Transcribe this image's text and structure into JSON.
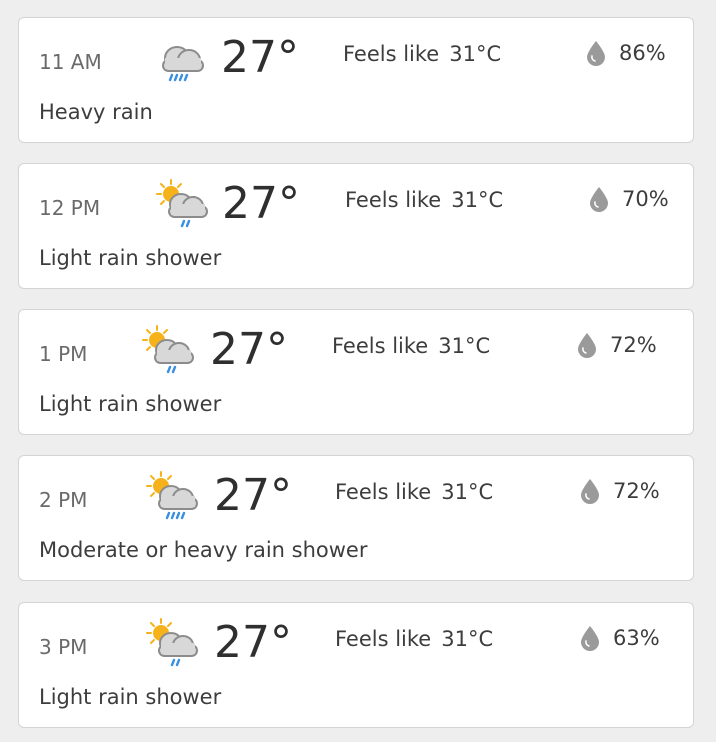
{
  "forecast": [
    {
      "time": "11 AM",
      "icon": "heavy-rain-icon",
      "temp": "27°",
      "feels_label": "Feels like",
      "feels_value": "31°C",
      "humidity": "86%",
      "condition": "Heavy rain"
    },
    {
      "time": "12 PM",
      "icon": "light-rain-shower-icon",
      "temp": "27°",
      "feels_label": "Feels like",
      "feels_value": "31°C",
      "humidity": "70%",
      "condition": "Light rain shower"
    },
    {
      "time": "1 PM",
      "icon": "light-rain-shower-icon",
      "temp": "27°",
      "feels_label": "Feels like",
      "feels_value": "31°C",
      "humidity": "72%",
      "condition": "Light rain shower"
    },
    {
      "time": "2 PM",
      "icon": "heavy-rain-shower-icon",
      "temp": "27°",
      "feels_label": "Feels like",
      "feels_value": "31°C",
      "humidity": "72%",
      "condition": "Moderate or heavy rain shower"
    },
    {
      "time": "3 PM",
      "icon": "light-rain-shower-icon",
      "temp": "27°",
      "feels_label": "Feels like",
      "feels_value": "31°C",
      "humidity": "63%",
      "condition": "Light rain shower"
    }
  ],
  "colors": {
    "rain": "#3b8fe0",
    "sun": "#f6b21a",
    "cloud": "#c6c6c6",
    "drop": "#9a9a9a"
  }
}
